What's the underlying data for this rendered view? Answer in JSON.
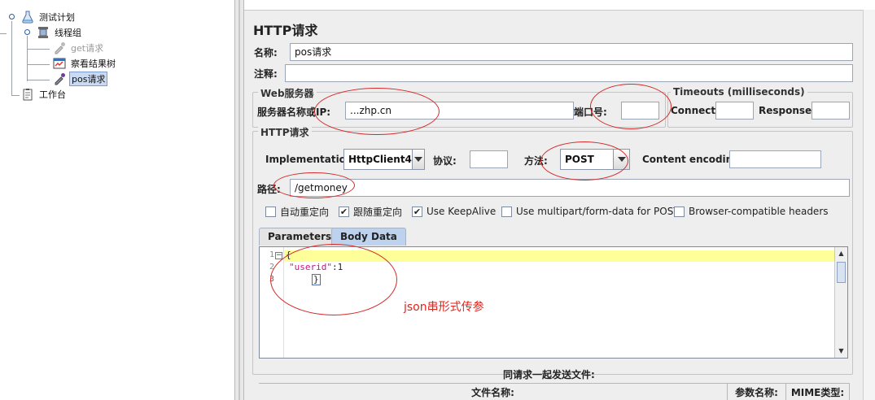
{
  "tree": {
    "items": [
      {
        "label": "测试计划",
        "icon": "flask-icon"
      },
      {
        "label": "线程组",
        "icon": "spool-icon"
      },
      {
        "label": "get请求",
        "icon": "pipette-icon",
        "disabled": true
      },
      {
        "label": "察看结果树",
        "icon": "tree-results-icon"
      },
      {
        "label": "pos请求",
        "icon": "pipette-icon",
        "selected": true
      },
      {
        "label": "工作台",
        "icon": "clipboard-icon"
      }
    ]
  },
  "panel": {
    "title": "HTTP请求",
    "name_label": "名称:",
    "name_value": "pos请求",
    "comment_label": "注释:",
    "comment_value": "",
    "web_server": {
      "legend": "Web服务器",
      "server_label": "服务器名称或IP:",
      "server_value": "...zhp.cn",
      "port_label": "端口号:",
      "port_value": ""
    },
    "timeouts": {
      "legend": "Timeouts (milliseconds)",
      "connect_label": "Connect:",
      "connect_value": "",
      "response_label": "Response:",
      "response_value": ""
    },
    "http": {
      "legend": "HTTP请求",
      "implementation_label": "Implementation:",
      "implementation_value": "HttpClient4",
      "protocol_label": "协议:",
      "protocol_value": "",
      "method_label": "方法:",
      "method_value": "POST",
      "encoding_label": "Content encoding:",
      "encoding_value": "",
      "path_label": "路径:",
      "path_value": "/getmoney"
    },
    "options": [
      {
        "label": "自动重定向",
        "checked": false
      },
      {
        "label": "跟随重定向",
        "checked": true
      },
      {
        "label": "Use KeepAlive",
        "checked": true
      },
      {
        "label": "Use multipart/form-data for POST",
        "checked": false
      },
      {
        "label": "Browser-compatible headers",
        "checked": false
      }
    ],
    "tabs": [
      {
        "label": "Parameters",
        "active": false
      },
      {
        "label": "Body Data",
        "active": true
      }
    ],
    "body_lines": [
      {
        "num": "1",
        "text": "{"
      },
      {
        "num": "2",
        "key": "\"userid\"",
        "value": ":1"
      },
      {
        "num": "3",
        "text": "}"
      }
    ],
    "annotation": "json串形式传参",
    "files_title": "同请求一起发送文件:",
    "files_columns": [
      "文件名称:",
      "参数名称:",
      "MIME类型:"
    ]
  },
  "colors": {
    "selection_bg": "#c9daf2",
    "highlight_line": "#ffff99",
    "annotation_red": "#e0231c",
    "json_key": "#c71585"
  }
}
